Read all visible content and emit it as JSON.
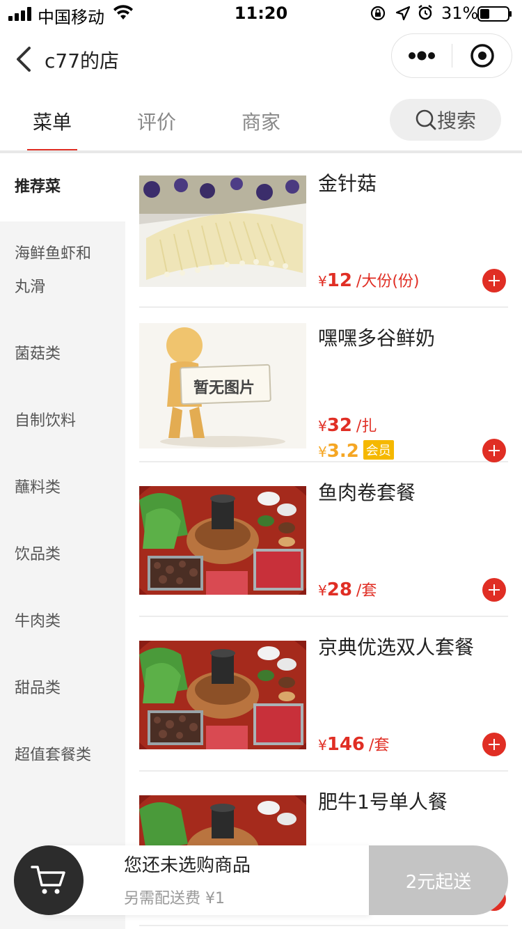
{
  "status_bar": {
    "carrier": "中国移动",
    "time": "11:20",
    "battery": "31%"
  },
  "nav": {
    "title": "c77的店",
    "icons": [
      "back-icon",
      "more-icon",
      "close-target-icon"
    ]
  },
  "tabs": [
    {
      "label": "菜单",
      "active": true
    },
    {
      "label": "评价",
      "active": false
    },
    {
      "label": "商家",
      "active": false
    }
  ],
  "search": {
    "label": "搜索",
    "icon": "search-icon"
  },
  "categories": [
    {
      "label": "推荐菜",
      "active": true
    },
    {
      "label": "海鲜鱼虾和丸滑",
      "active": false
    },
    {
      "label": "菌菇类",
      "active": false
    },
    {
      "label": "自制饮料",
      "active": false
    },
    {
      "label": "蘸料类",
      "active": false
    },
    {
      "label": "饮品类",
      "active": false
    },
    {
      "label": "牛肉类",
      "active": false
    },
    {
      "label": "甜品类",
      "active": false
    },
    {
      "label": "超值套餐类",
      "active": false
    }
  ],
  "products": [
    {
      "name": "金针菇",
      "currency": "¥",
      "price": "12",
      "unit": "/大份(份)",
      "image": "enoki-mushroom-photo"
    },
    {
      "name": "嘿嘿多谷鲜奶",
      "currency": "¥",
      "price": "32",
      "unit": "/扎",
      "member_price": "3.2",
      "member_label": "会员",
      "image": "no-image-placeholder",
      "placeholder_text": "暂无图片"
    },
    {
      "name": "鱼肉卷套餐",
      "currency": "¥",
      "price": "28",
      "unit": "/套",
      "image": "hotpot-set-photo"
    },
    {
      "name": "京典优选双人套餐",
      "currency": "¥",
      "price": "146",
      "unit": "/套",
      "image": "hotpot-set-photo"
    },
    {
      "name": "肥牛1号单人餐",
      "image": "hotpot-set-photo"
    }
  ],
  "cart": {
    "message": "您还未选购商品",
    "delivery_fee": "另需配送费 ¥1",
    "min_order": "2元起送"
  },
  "colors": {
    "accent": "#e02e24",
    "member": "#f5a623",
    "cart_dark": "#2c2c2c",
    "cart_disabled": "#c4c4c4"
  }
}
